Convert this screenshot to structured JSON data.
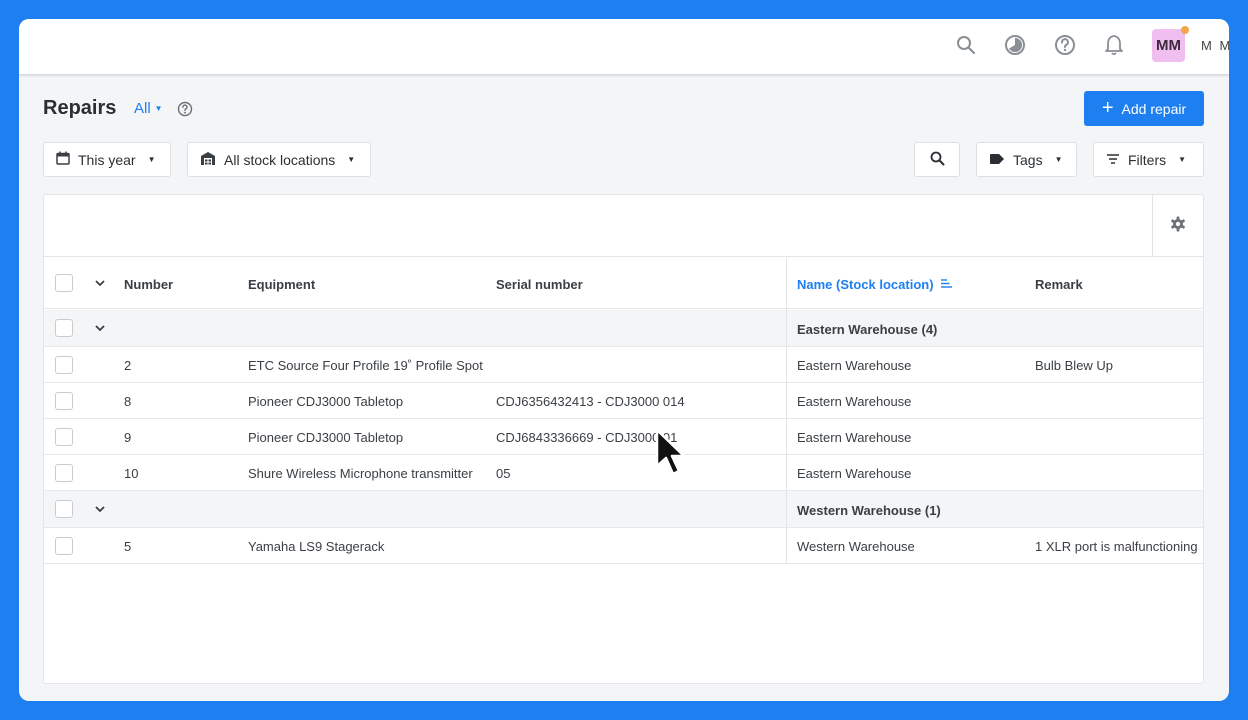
{
  "topbar": {
    "icons": [
      "search-icon",
      "timer-icon",
      "help-icon",
      "bell-icon"
    ],
    "avatar_initials": "MM",
    "user_name": "M M"
  },
  "header": {
    "title": "Repairs",
    "view_filter": "All",
    "add_button_label": "Add repair"
  },
  "filters": {
    "date_label": "This year",
    "location_label": "All stock locations",
    "tags_label": "Tags",
    "filters_label": "Filters"
  },
  "table": {
    "columns": {
      "number": "Number",
      "equipment": "Equipment",
      "serial": "Serial number",
      "location": "Name (Stock location)",
      "remark": "Remark"
    },
    "groups": [
      {
        "label": "Eastern Warehouse (4)",
        "rows": [
          {
            "number": "2",
            "equipment": "ETC Source Four Profile 19˚ Profile Spot",
            "serial": "",
            "location": "Eastern Warehouse",
            "remark": "Bulb Blew Up"
          },
          {
            "number": "8",
            "equipment": "Pioneer CDJ3000 Tabletop",
            "serial": "CDJ6356432413 - CDJ3000 014",
            "location": "Eastern Warehouse",
            "remark": ""
          },
          {
            "number": "9",
            "equipment": "Pioneer CDJ3000 Tabletop",
            "serial": "CDJ6843336669 - CDJ3000 01",
            "location": "Eastern Warehouse",
            "remark": ""
          },
          {
            "number": "10",
            "equipment": "Shure Wireless Microphone transmitter",
            "serial": "05",
            "location": "Eastern Warehouse",
            "remark": ""
          }
        ]
      },
      {
        "label": "Western Warehouse (1)",
        "rows": [
          {
            "number": "5",
            "equipment": "Yamaha LS9 Stagerack",
            "serial": "",
            "location": "Western Warehouse",
            "remark": "1 XLR port is malfunctioning"
          }
        ]
      }
    ]
  },
  "colors": {
    "accent": "#1d7ff0",
    "avatar_bg": "#f0bff0",
    "notification_dot": "#f3a54a"
  }
}
